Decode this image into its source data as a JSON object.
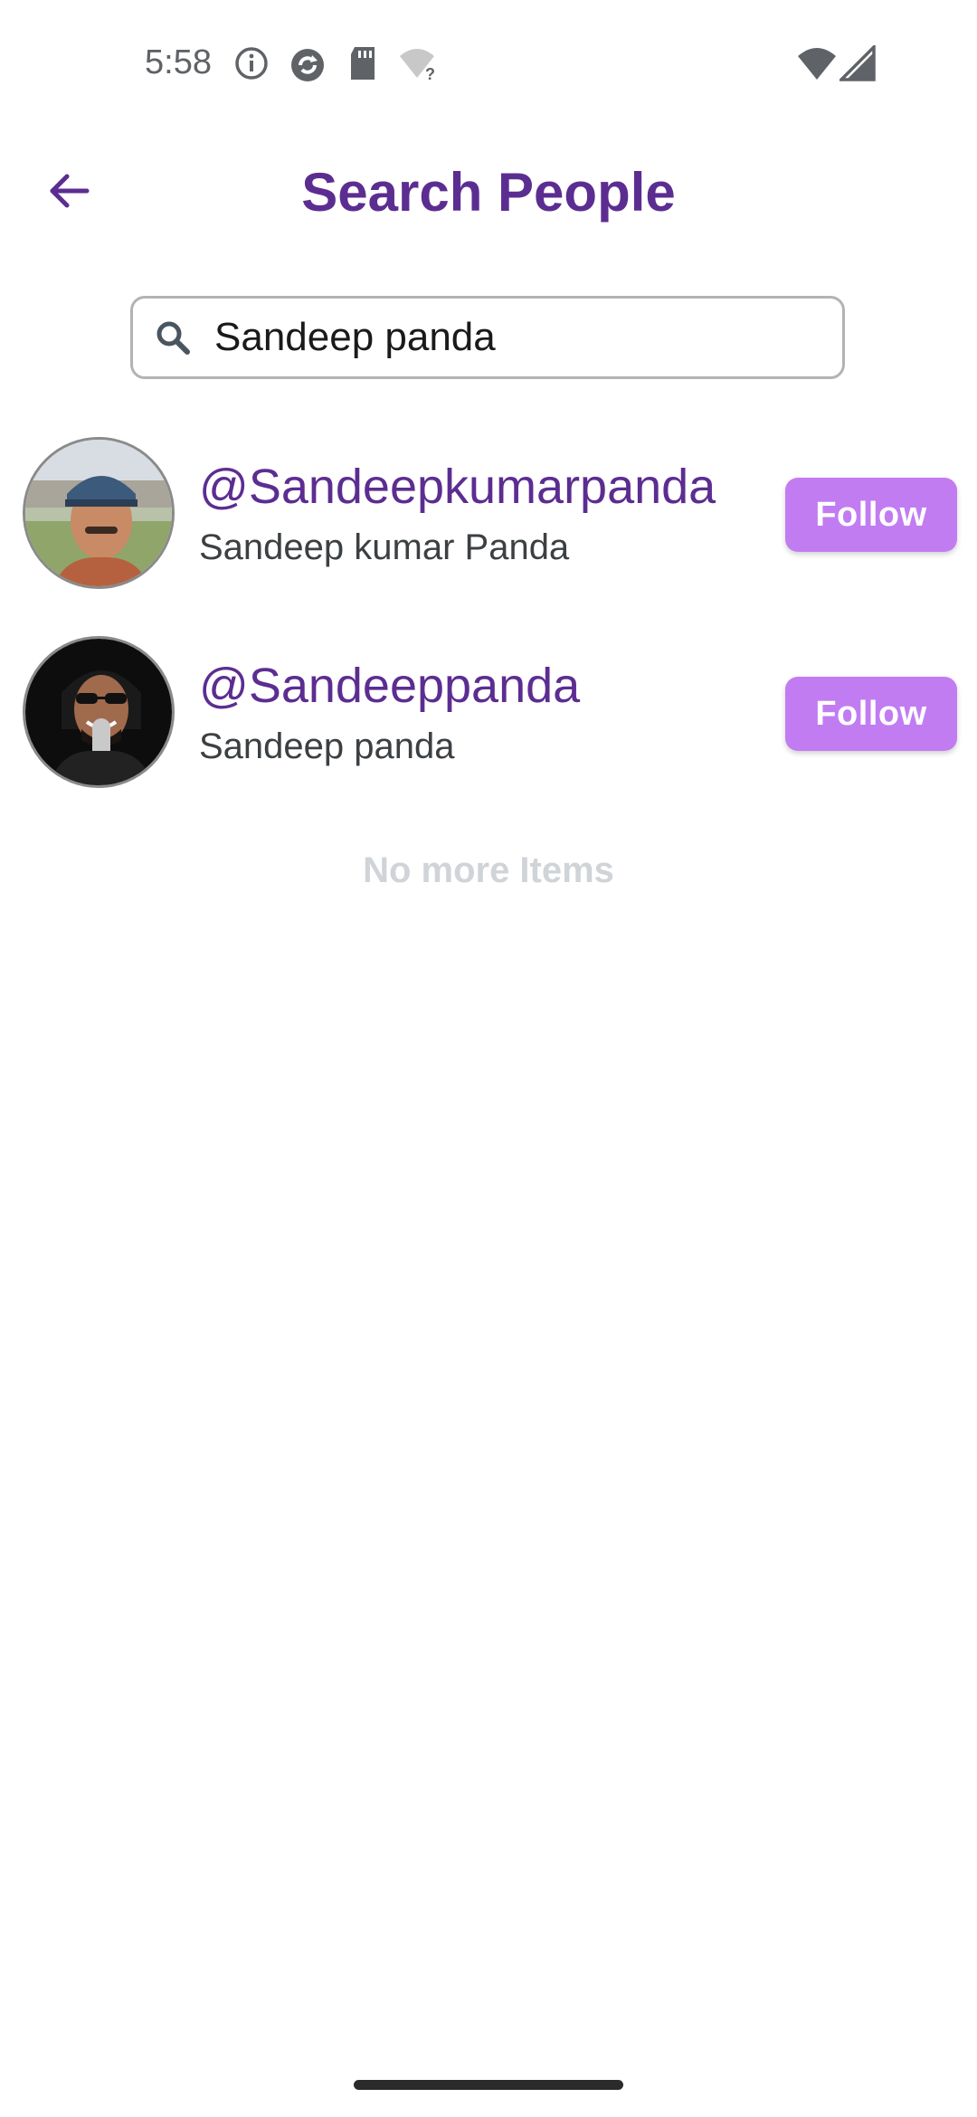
{
  "status_bar": {
    "time": "5:58",
    "icons": [
      "info-icon",
      "sync-icon",
      "sd-card-icon",
      "wifi-question-icon",
      "wifi-icon",
      "cell-signal-icon"
    ]
  },
  "header": {
    "title": "Search People",
    "back_icon": "arrow-left-icon"
  },
  "search": {
    "value": "Sandeep panda",
    "icon": "search-icon"
  },
  "results": [
    {
      "username": "@Sandeepkumarpanda",
      "name": "Sandeep kumar Panda",
      "button_label": "Follow"
    },
    {
      "username": "@Sandeeppanda",
      "name": "Sandeep panda",
      "button_label": "Follow"
    }
  ],
  "footer_text": "No more Items",
  "colors": {
    "accent": "#5c2d91",
    "button": "#c27cf2",
    "muted": "#d0d4d8"
  }
}
